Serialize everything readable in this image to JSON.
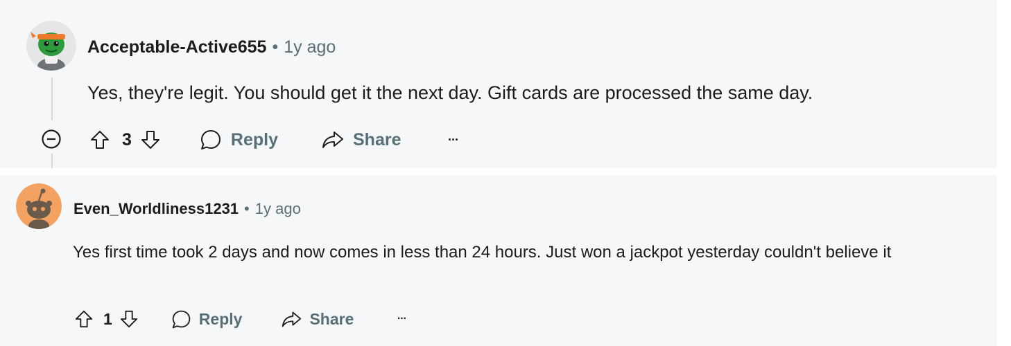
{
  "comments": [
    {
      "author": "Acceptable-Active655",
      "separator": "•",
      "age": "1y ago",
      "body": "Yes, they're legit. You should get it the next day. Gift cards are processed the same day.",
      "score": "3",
      "reply_label": "Reply",
      "share_label": "Share",
      "more_label": "···",
      "avatar_icon": "green-character-avatar-icon"
    },
    {
      "author": "Even_Worldliness1231",
      "separator": "•",
      "age": "1y ago",
      "body": "Yes first time took 2 days and now comes in less than 24 hours. Just won a jackpot yesterday couldn't believe it",
      "score": "1",
      "reply_label": "Reply",
      "share_label": "Share",
      "more_label": "···",
      "avatar_icon": "snoo-avatar-icon"
    }
  ],
  "colors": {
    "card_bg": "#f6f7f8",
    "text": "#1c1c1c",
    "muted": "#576f76",
    "thread_line": "#d3d6da",
    "avatar2_bg": "#f4a261"
  }
}
